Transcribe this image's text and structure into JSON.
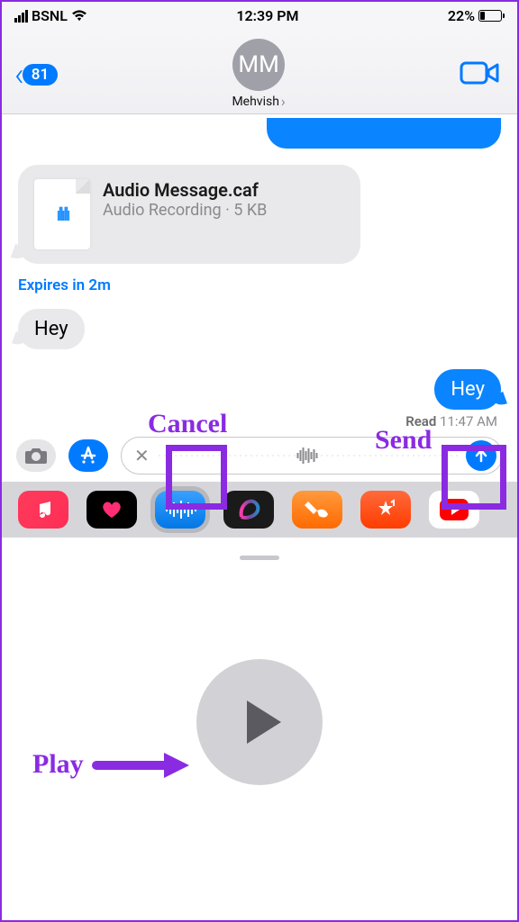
{
  "status": {
    "carrier": "BSNL",
    "time": "12:39 PM",
    "battery_pct": "22%"
  },
  "nav": {
    "back_count": "81",
    "contact_initials": "MM",
    "contact_name": "Mehvish"
  },
  "messages": {
    "file": {
      "name": "Audio Message.caf",
      "desc": "Audio Recording · 5 KB"
    },
    "expires": "Expires in 2m",
    "in1": "Hey",
    "out1": "Hey",
    "receipt_label": "Read",
    "receipt_time": "11:47 AM"
  },
  "annotations": {
    "cancel": "Cancel",
    "send": "Send",
    "play": "Play"
  }
}
